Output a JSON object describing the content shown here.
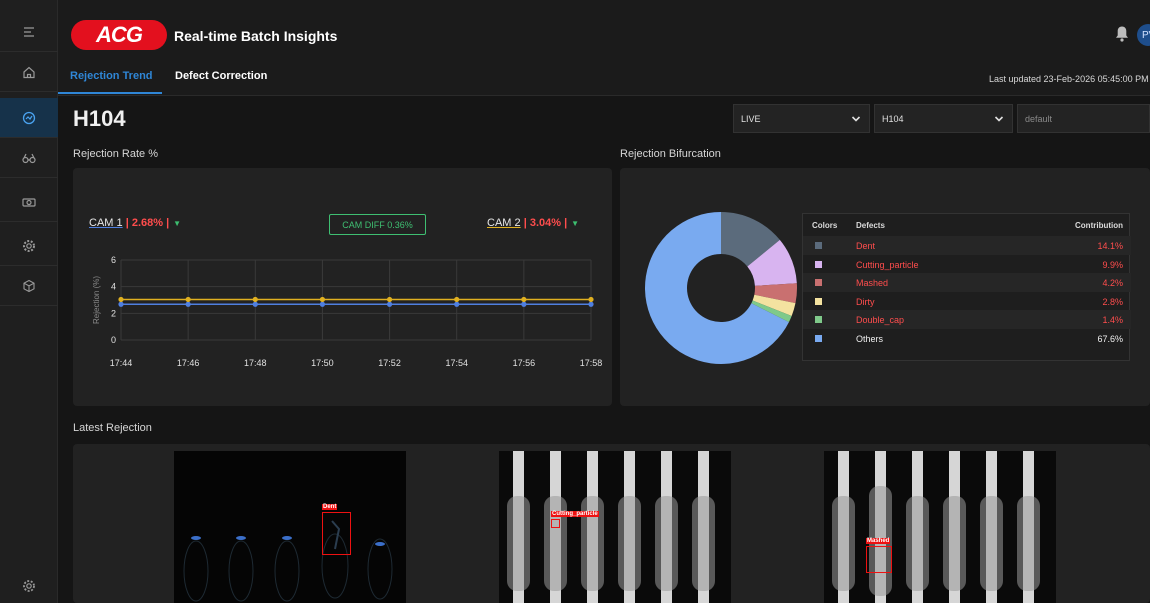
{
  "header": {
    "logo_text": "ACG",
    "app_title": "Real-time Batch Insights",
    "avatar_initials": "PV",
    "last_updated": "Last updated 23-Feb-2026 05:45:00 PM"
  },
  "tabs": [
    {
      "label": "Rejection Trend",
      "active": true
    },
    {
      "label": "Defect Correction",
      "active": false
    }
  ],
  "batch": {
    "title": "H104",
    "mode_select": "LIVE",
    "batch_select": "H104",
    "config_select": "default"
  },
  "sections": {
    "rate": "Rejection Rate %",
    "bifurcation": "Rejection Bifurcation",
    "latest": "Latest Rejection"
  },
  "cams": {
    "cam1_name": "CAM 1",
    "cam1_value": "| 2.68% |",
    "cam2_name": "CAM 2",
    "cam2_value": "| 3.04% |",
    "diff": "CAM DIFF 0.36%"
  },
  "colors": {
    "cam1": "#4f7fe0",
    "cam2": "#e0b020",
    "accent": "#2f86d6",
    "brand": "#e3101e"
  },
  "chart_data": [
    {
      "type": "line",
      "ylabel": "Rejection (%)",
      "x": [
        "17:44",
        "17:46",
        "17:48",
        "17:50",
        "17:52",
        "17:54",
        "17:56",
        "17:58"
      ],
      "ylim": [
        0,
        6
      ],
      "yticks": [
        0,
        2,
        4,
        6
      ],
      "series": [
        {
          "name": "CAM 1",
          "values": [
            2.68,
            2.68,
            2.68,
            2.68,
            2.68,
            2.68,
            2.68,
            2.68
          ]
        },
        {
          "name": "CAM 2",
          "values": [
            3.04,
            3.04,
            3.04,
            3.04,
            3.04,
            3.04,
            3.04,
            3.04
          ]
        }
      ],
      "grid": true
    },
    {
      "type": "pie",
      "donut": true,
      "table_headers": [
        "Colors",
        "Defects",
        "Contribution"
      ],
      "slices": [
        {
          "label": "Dent",
          "value": 14.1,
          "display": "14.1%",
          "color": "#5b6b7c"
        },
        {
          "label": "Cutting_particle",
          "value": 9.9,
          "display": "9.9%",
          "color": "#d8b4f0"
        },
        {
          "label": "Mashed",
          "value": 4.2,
          "display": "4.2%",
          "color": "#c97070"
        },
        {
          "label": "Dirty",
          "value": 2.8,
          "display": "2.8%",
          "color": "#f4e2a0"
        },
        {
          "label": "Double_cap",
          "value": 1.4,
          "display": "1.4%",
          "color": "#7fc98a"
        },
        {
          "label": "Others",
          "value": 67.6,
          "display": "67.6%",
          "color": "#79aaf0"
        }
      ]
    }
  ],
  "latest_rejections": [
    {
      "label": "Dent"
    },
    {
      "label": "Cutting_particle"
    },
    {
      "label": "Mashed"
    }
  ],
  "icons": [
    "menu-icon",
    "home-icon",
    "trend-icon",
    "binoculars-icon",
    "camera-icon",
    "gear-icon",
    "cube-icon",
    "settings-icon",
    "bell-icon",
    "chevron-down-icon"
  ]
}
